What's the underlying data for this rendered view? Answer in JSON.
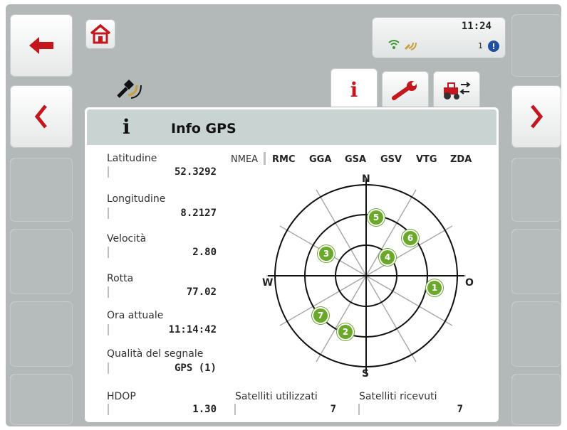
{
  "status": {
    "time": "11:24",
    "count": "1"
  },
  "panel": {
    "info_glyph": "i",
    "title": "Info GPS"
  },
  "tabs": [
    {
      "icon": "info-icon",
      "glyph": "i",
      "active": true
    },
    {
      "icon": "wrench-icon",
      "active": false
    },
    {
      "icon": "tractor-settings-icon",
      "active": false
    }
  ],
  "fields": {
    "latitude": {
      "label": "Latitudine",
      "value": "52.3292"
    },
    "longitude": {
      "label": "Longitudine",
      "value": "8.2127"
    },
    "speed": {
      "label": "Velocità",
      "value": "2.80"
    },
    "heading": {
      "label": "Rotta",
      "value": "77.02"
    },
    "time": {
      "label": "Ora attuale",
      "value": "11:14:42"
    },
    "quality": {
      "label": "Qualità del segnale",
      "value": "GPS (1)"
    },
    "hdop": {
      "label": "HDOP",
      "value": "1.30"
    },
    "sats_used": {
      "label": "Satelliti utilizzati",
      "value": "7"
    },
    "sats_recv": {
      "label": "Satelliti ricevuti",
      "value": "7"
    }
  },
  "nmea": {
    "label": "NMEA",
    "items": [
      "RMC",
      "GGA",
      "GSA",
      "GSV",
      "VTG",
      "ZDA"
    ]
  },
  "compass": {
    "n": "N",
    "s": "S",
    "w": "W",
    "e": "O"
  },
  "satellites": [
    "1",
    "2",
    "3",
    "4",
    "5",
    "6",
    "7"
  ],
  "colors": {
    "satellite": "#6aa82a",
    "accent": "#c4161c",
    "header": "#c9d3d2"
  }
}
